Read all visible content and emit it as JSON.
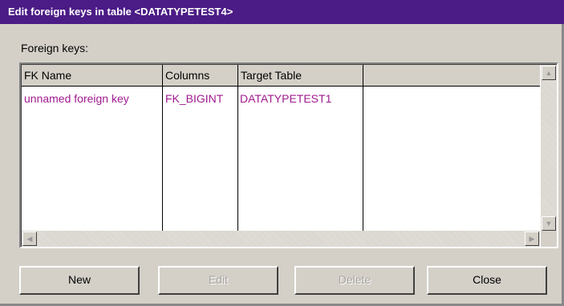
{
  "window": {
    "title": "Edit foreign keys in table <DATATYPETEST4>"
  },
  "foreign_keys_label": "Foreign keys:",
  "table": {
    "columns": [
      "FK Name",
      "Columns",
      "Target Table"
    ],
    "rows": [
      [
        "unnamed foreign key",
        "FK_BIGINT",
        "DATATYPETEST1"
      ]
    ]
  },
  "buttons": {
    "new": {
      "label": "New",
      "enabled": true
    },
    "edit": {
      "label": "Edit",
      "enabled": false
    },
    "delete": {
      "label": "Delete",
      "enabled": false
    },
    "close": {
      "label": "Close",
      "enabled": true
    }
  },
  "colors": {
    "titlebar": "#4b1b86",
    "row_text": "#a0198f",
    "dialog_bg": "#d4d0c8"
  },
  "icons": {
    "scroll_up": "arrow-up-icon",
    "scroll_down": "arrow-down-icon",
    "scroll_left": "arrow-left-icon",
    "scroll_right": "arrow-right-icon"
  }
}
